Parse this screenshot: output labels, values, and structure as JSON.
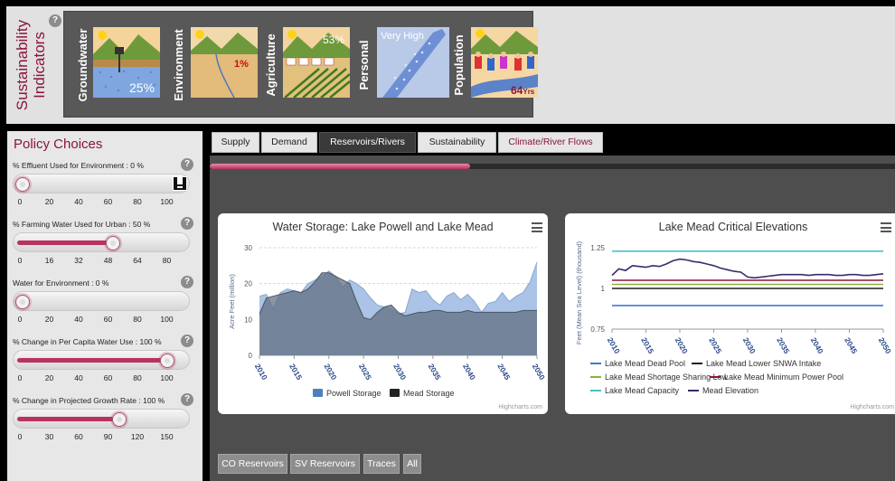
{
  "indicators": {
    "title_line1": "Sustainability",
    "title_line2": "Indicators",
    "help": "?",
    "items": [
      {
        "label": "Groundwater",
        "value": "25%"
      },
      {
        "label": "Environment",
        "value": "1%"
      },
      {
        "label": "Agriculture",
        "value": "53%"
      },
      {
        "label": "Personal",
        "value": "Very High"
      },
      {
        "label": "Population",
        "value": "64",
        "unit": "Yrs"
      }
    ]
  },
  "policy": {
    "title": "Policy Choices",
    "help": "?",
    "sliders": [
      {
        "label": "% Effluent Used for Environment : 0 %",
        "value": 0,
        "ticks": [
          "0",
          "20",
          "40",
          "60",
          "80",
          "100"
        ],
        "min": 0,
        "max": 100
      },
      {
        "label": "% Farming Water Used for Urban : 50 %",
        "value": 50,
        "ticks": [
          "0",
          "16",
          "32",
          "48",
          "64",
          "80"
        ],
        "min": 0,
        "max": 80
      },
      {
        "label": "Water for Environment : 0 %",
        "value": 0,
        "ticks": [
          "0",
          "20",
          "40",
          "60",
          "80",
          "100"
        ],
        "min": 0,
        "max": 100
      },
      {
        "label": "% Change in Per Capita Water Use : 100 %",
        "value": 100,
        "ticks": [
          "0",
          "20",
          "40",
          "60",
          "80",
          "100"
        ],
        "min": 0,
        "max": 100
      },
      {
        "label": "% Change in Projected Growth Rate : 100 %",
        "value": 100,
        "ticks": [
          "0",
          "30",
          "60",
          "90",
          "120",
          "150"
        ],
        "min": 0,
        "max": 150
      }
    ]
  },
  "tabs": [
    {
      "label": "Supply",
      "active": false
    },
    {
      "label": "Demand",
      "active": false
    },
    {
      "label": "Reservoirs/Rivers",
      "active": true
    },
    {
      "label": "Sustainability",
      "active": false
    },
    {
      "label": "Climate/River Flows",
      "active": false
    }
  ],
  "progress": 0.38,
  "charts": {
    "credits": "Highcharts.com",
    "storage_legend": [
      {
        "name": "Powell Storage",
        "color": "#4f7fbd"
      },
      {
        "name": "Mead Storage",
        "color": "#222222"
      }
    ],
    "mead_legend": [
      {
        "name": "Lake Mead Dead Pool",
        "color": "#3d7ad6"
      },
      {
        "name": "Lake Mead Lower SNWA Intake",
        "color": "#1e1e1e"
      },
      {
        "name": "Lake Mead Shortage Sharing Low",
        "color": "#8ab33a"
      },
      {
        "name": "Lake Mead Minimum Power Pool",
        "color": "#8a1538"
      },
      {
        "name": "Lake Mead Capacity",
        "color": "#4dbfc9"
      },
      {
        "name": "Mead Elevation",
        "color": "#3b2a6b"
      }
    ]
  },
  "chart_data": [
    {
      "type": "area",
      "title": "Water Storage: Lake Powell and Lake Mead",
      "ylabel": "Acre Feet (million)",
      "xlabel": "",
      "ylim": [
        0,
        30
      ],
      "yticks": [
        "0",
        "10",
        "20",
        "30"
      ],
      "xticks": [
        "2010",
        "2015",
        "2020",
        "2025",
        "2030",
        "2035",
        "2040",
        "2045",
        "2050"
      ],
      "grid": true,
      "legend": "bottom",
      "x": [
        2010,
        2011,
        2012,
        2013,
        2014,
        2015,
        2016,
        2017,
        2018,
        2019,
        2020,
        2021,
        2022,
        2023,
        2024,
        2025,
        2026,
        2027,
        2028,
        2029,
        2030,
        2031,
        2032,
        2033,
        2034,
        2035,
        2036,
        2037,
        2038,
        2039,
        2040,
        2041,
        2042,
        2043,
        2044,
        2045,
        2046,
        2047,
        2048,
        2049,
        2050
      ],
      "series": [
        {
          "name": "Powell Storage",
          "values": [
            16.5,
            17.0,
            13.0,
            17.5,
            18.5,
            18.0,
            17.5,
            20.0,
            21.0,
            22.0,
            23.5,
            22.0,
            19.0,
            21.0,
            20.0,
            18.5,
            16.0,
            14.0,
            13.5,
            13.0,
            11.5,
            12.0,
            18.5,
            17.5,
            18.0,
            15.5,
            14.0,
            16.5,
            17.5,
            15.5,
            17.0,
            15.0,
            12.0,
            14.5,
            15.0,
            17.5,
            15.0,
            16.5,
            17.5,
            20.5,
            26.0
          ]
        },
        {
          "name": "Mead Storage",
          "values": [
            11.5,
            16.0,
            16.5,
            17.0,
            17.5,
            18.0,
            17.5,
            18.5,
            20.5,
            23.0,
            23.0,
            22.0,
            21.0,
            20.0,
            15.0,
            10.5,
            10.0,
            12.0,
            13.5,
            14.0,
            12.0,
            11.0,
            11.5,
            12.0,
            12.0,
            12.5,
            12.5,
            12.0,
            12.0,
            12.0,
            12.5,
            12.0,
            12.0,
            12.0,
            12.0,
            12.0,
            12.0,
            12.0,
            12.5,
            12.5,
            12.5
          ]
        }
      ]
    },
    {
      "type": "line",
      "title": "Lake Mead Critical Elevations",
      "ylabel": "Feet (Mean Sea Level) (thousand)",
      "xlabel": "",
      "ylim": [
        0.75,
        1.25
      ],
      "yticks": [
        "0.75",
        "1",
        "1.25"
      ],
      "xticks": [
        "2010",
        "2015",
        "2020",
        "2025",
        "2030",
        "2035",
        "2040",
        "2045",
        "2050"
      ],
      "grid": true,
      "legend": "bottom",
      "x": [
        2010,
        2011,
        2012,
        2013,
        2014,
        2015,
        2016,
        2017,
        2018,
        2019,
        2020,
        2021,
        2022,
        2023,
        2024,
        2025,
        2026,
        2027,
        2028,
        2029,
        2030,
        2031,
        2032,
        2033,
        2034,
        2035,
        2036,
        2037,
        2038,
        2039,
        2040,
        2041,
        2042,
        2043,
        2044,
        2045,
        2046,
        2047,
        2048,
        2049,
        2050
      ],
      "series": [
        {
          "name": "Lake Mead Dead Pool",
          "values": [
            0.895
          ]
        },
        {
          "name": "Lake Mead Lower SNWA Intake",
          "values": [
            1.0
          ]
        },
        {
          "name": "Lake Mead Shortage Sharing Low",
          "values": [
            1.025
          ]
        },
        {
          "name": "Lake Mead Minimum Power Pool",
          "values": [
            1.05
          ]
        },
        {
          "name": "Lake Mead Capacity",
          "values": [
            1.229
          ]
        },
        {
          "name": "Mead Elevation",
          "values": [
            1.08,
            1.12,
            1.11,
            1.14,
            1.135,
            1.13,
            1.14,
            1.135,
            1.15,
            1.17,
            1.18,
            1.175,
            1.165,
            1.16,
            1.15,
            1.14,
            1.125,
            1.115,
            1.105,
            1.1,
            1.07,
            1.065,
            1.07,
            1.075,
            1.08,
            1.085,
            1.085,
            1.085,
            1.085,
            1.08,
            1.085,
            1.085,
            1.085,
            1.08,
            1.08,
            1.085,
            1.085,
            1.08,
            1.08,
            1.085,
            1.09
          ]
        }
      ]
    }
  ],
  "bottom_buttons": [
    "CO Reservoirs",
    "SV Reservoirs",
    "Traces",
    "All"
  ]
}
